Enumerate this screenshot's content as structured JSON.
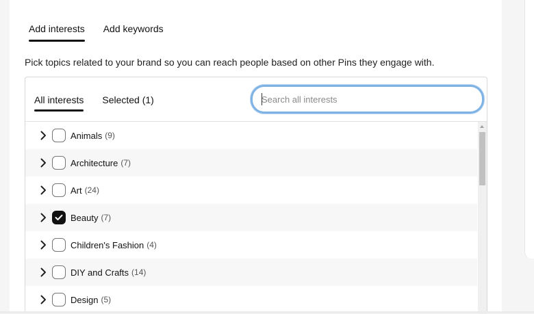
{
  "top_tabs": [
    {
      "label": "Add interests",
      "active": true
    },
    {
      "label": "Add keywords",
      "active": false
    }
  ],
  "description": "Pick topics related to your brand so you can reach people based on other Pins they engage with.",
  "interest_tabs": [
    {
      "label": "All interests",
      "active": true
    },
    {
      "label": "Selected (1)",
      "active": false
    }
  ],
  "search": {
    "placeholder": "Search all interests",
    "value": ""
  },
  "interests": [
    {
      "label": "Animals",
      "count": "(9)",
      "checked": false
    },
    {
      "label": "Architecture",
      "count": "(7)",
      "checked": false
    },
    {
      "label": "Art",
      "count": "(24)",
      "checked": false
    },
    {
      "label": "Beauty",
      "count": "(7)",
      "checked": true
    },
    {
      "label": "Children's Fashion",
      "count": "(4)",
      "checked": false
    },
    {
      "label": "DIY and Crafts",
      "count": "(14)",
      "checked": false
    },
    {
      "label": "Design",
      "count": "(5)",
      "checked": false
    }
  ],
  "colors": {
    "focus_ring": "#7fb2e5",
    "checked": "#111111",
    "text": "#111111"
  },
  "icons": {
    "expand": "chevron-right-icon",
    "check": "checkmark-icon"
  }
}
